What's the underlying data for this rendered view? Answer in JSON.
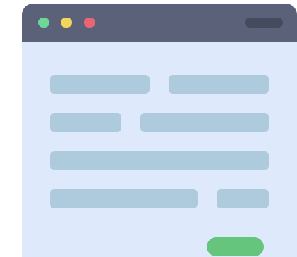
{
  "colors": {
    "titlebar": "#5b6179",
    "window_body": "#deeafb",
    "titlebar_pill": "#454b5f",
    "dot_close": "#e96575",
    "dot_minimize": "#f3d55b",
    "dot_maximize": "#6ed696",
    "field": "#aecadd",
    "submit_button": "#66c57d"
  },
  "titlebar": {
    "controls": [
      {
        "name": "maximize",
        "color": "#6ed696"
      },
      {
        "name": "minimize",
        "color": "#f3d55b"
      },
      {
        "name": "close",
        "color": "#e96575"
      }
    ]
  },
  "form": {
    "field_count": 7,
    "submit_label": ""
  }
}
